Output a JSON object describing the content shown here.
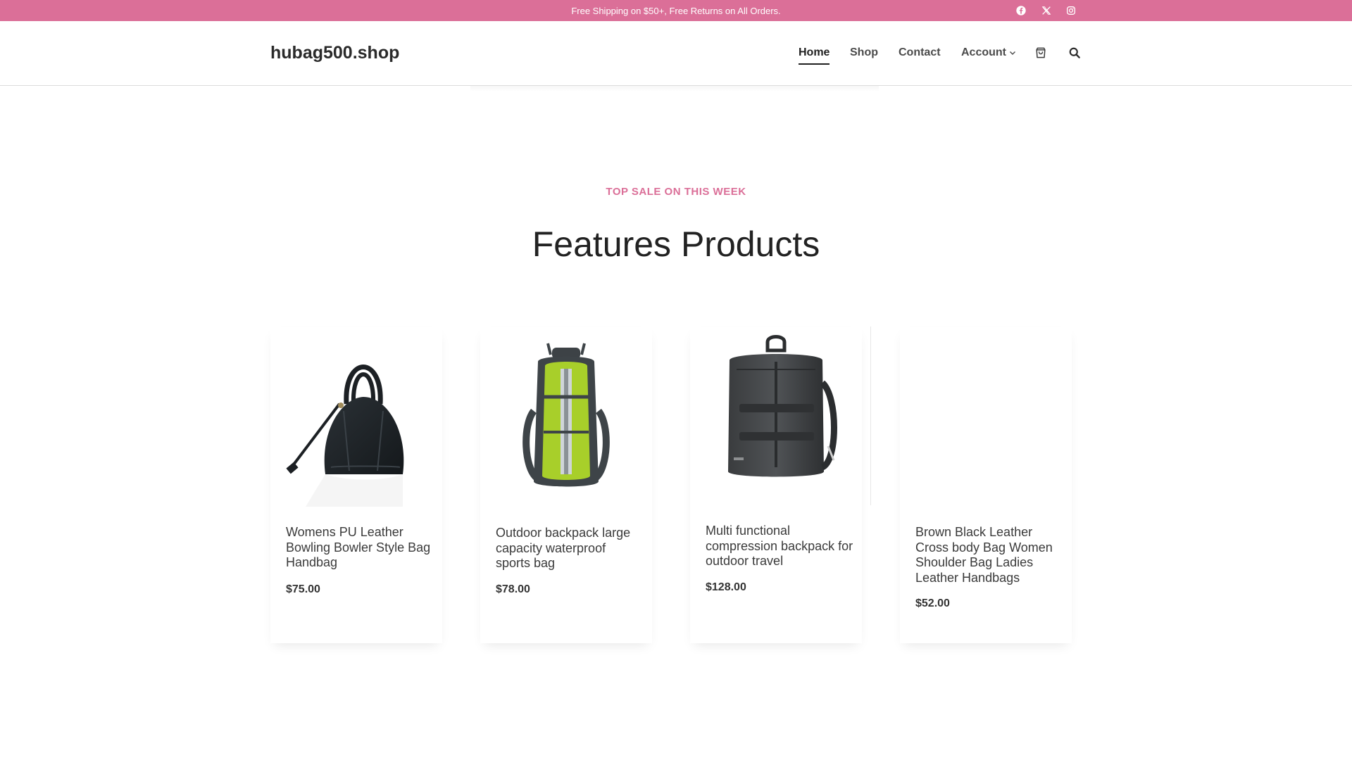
{
  "topbar": {
    "announcement": "Free Shipping on $50+, Free Returns on All Orders.",
    "social": [
      "facebook-icon",
      "x-icon",
      "instagram-icon"
    ]
  },
  "header": {
    "logo": "hubag500.shop",
    "nav": [
      {
        "label": "Home",
        "active": true
      },
      {
        "label": "Shop",
        "active": false
      },
      {
        "label": "Contact",
        "active": false
      },
      {
        "label": "Account",
        "active": false,
        "has_dropdown": true
      }
    ],
    "icons": [
      "cart-icon",
      "search-icon"
    ]
  },
  "section": {
    "eyebrow": "TOP SALE ON THIS WEEK",
    "title": "Features Products"
  },
  "products": [
    {
      "title": "Womens PU Leather Bowling Bowler Style Bag Handbag",
      "price": "$75.00",
      "image": "black-bowler-handbag"
    },
    {
      "title": "Outdoor backpack large capacity waterproof sports bag",
      "price": "$78.00",
      "image": "green-hiking-backpack"
    },
    {
      "title": "Multi functional compression backpack for outdoor travel",
      "price": "$128.00",
      "image": "gray-travel-backpack"
    },
    {
      "title": "Brown Black Leather Cross body Bag Women Shoulder Bag Ladies Leather Handbags",
      "price": "$52.00",
      "image": "none"
    }
  ],
  "colors": {
    "accent": "#db6f98",
    "text": "#2d2d2d"
  }
}
